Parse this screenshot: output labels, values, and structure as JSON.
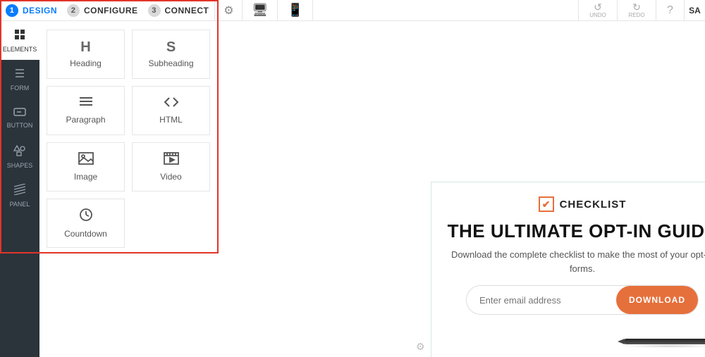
{
  "steps": [
    {
      "num": "1",
      "label": "DESIGN",
      "active": true
    },
    {
      "num": "2",
      "label": "CONFIGURE",
      "active": false
    },
    {
      "num": "3",
      "label": "CONNECT",
      "active": false
    }
  ],
  "top_actions": {
    "undo": "UNDO",
    "redo": "REDO",
    "save": "SA"
  },
  "sidebar": [
    {
      "label": "ELEMENTS",
      "icon": "◼◼\n◼◼",
      "active": true
    },
    {
      "label": "FORM",
      "icon": "≣",
      "active": false
    },
    {
      "label": "BUTTON",
      "icon": "▭",
      "active": false
    },
    {
      "label": "SHAPES",
      "icon": "◇",
      "active": false
    },
    {
      "label": "PANEL",
      "icon": "▨",
      "active": false
    }
  ],
  "elements": [
    {
      "icon": "H",
      "label": "Heading"
    },
    {
      "icon": "S",
      "label": "Subheading"
    },
    {
      "icon": "≡",
      "label": "Paragraph"
    },
    {
      "icon": "< >",
      "label": "HTML"
    },
    {
      "icon": "◫",
      "label": "Image"
    },
    {
      "icon": "▦",
      "label": "Video"
    },
    {
      "icon": "◔",
      "label": "Countdown"
    }
  ],
  "canvas": {
    "checklist": "CHECKLIST",
    "title": "THE ULTIMATE OPT-IN GUIDE",
    "subtitle": "Download the complete checklist to make the most of your opt-in forms.",
    "placeholder": "Enter email address",
    "button": "DOWNLOAD"
  }
}
